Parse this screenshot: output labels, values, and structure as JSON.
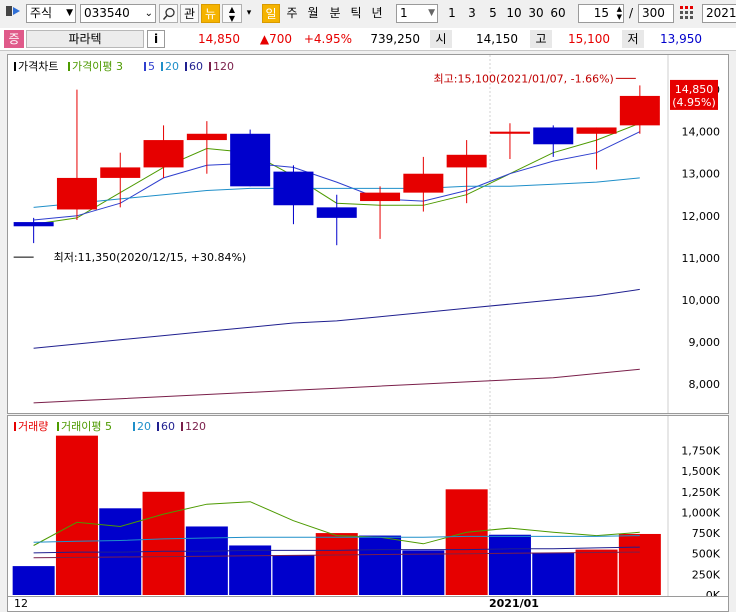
{
  "toolbar": {
    "market": "주식",
    "code": "033540",
    "btn_gwan": "관",
    "btn_new": "뉴",
    "period_buttons": [
      "일",
      "주",
      "월",
      "분",
      "틱",
      "년"
    ],
    "interval_value": "1",
    "quick_numbers": [
      "1",
      "3",
      "5",
      "10",
      "30",
      "60"
    ],
    "count_value": "15",
    "total_value": "300",
    "date_value": "2021/"
  },
  "infobar": {
    "badge": "증",
    "name": "파라텍",
    "info_btn": "i",
    "price": "14,850",
    "change": "▲700",
    "change_pct": "+4.95%",
    "volume": "739,250",
    "open_label": "시",
    "open": "14,150",
    "high_label": "고",
    "high": "15,100",
    "low_label": "저",
    "low": "13,950"
  },
  "colors": {
    "up": "#e60000",
    "down": "#0000cc",
    "ma5": "#4d9a00",
    "ma20": "#2f3fce",
    "ma60": "#1f8fc9",
    "ma120": "#7a1f4a"
  },
  "price_legend": [
    {
      "text": "가격차트",
      "color": "#000000"
    },
    {
      "text": "가격이평 3",
      "color": "#4d9a00"
    },
    {
      "text": "5",
      "color": "#2f3fce"
    },
    {
      "text": "20",
      "color": "#1f8fc9"
    },
    {
      "text": "60",
      "color": "#1f1f8f"
    },
    {
      "text": "120",
      "color": "#7a1f4a"
    }
  ],
  "volume_legend": [
    {
      "text": "거래량",
      "color": "#e60000"
    },
    {
      "text": "거래이평 5",
      "color": "#4d9a00"
    },
    {
      "text": "20",
      "color": "#1f8fc9"
    },
    {
      "text": "60",
      "color": "#1f1f8f"
    },
    {
      "text": "120",
      "color": "#7a1f4a"
    }
  ],
  "annotations": {
    "high": "최고:15,100(2021/01/07, -1.66%)",
    "low": "최저:11,350(2020/12/15, +30.84%)",
    "last_price": "14,850",
    "last_pct": "(4.95%)"
  },
  "x_labels": {
    "left": "12",
    "month": "2021/01"
  },
  "chart_data": [
    {
      "type": "candlestick",
      "title": "가격차트",
      "ylim": [
        7500,
        15300
      ],
      "y_ticks": [
        8000,
        9000,
        10000,
        11000,
        12000,
        13000,
        14000,
        15000
      ],
      "y_tick_labels": [
        "8,000",
        "9,000",
        "10,000",
        "11,000",
        "12,000",
        "13,000",
        "14,000",
        "15,000"
      ],
      "candles": [
        {
          "o": 11850,
          "h": 11950,
          "l": 11350,
          "c": 11750
        },
        {
          "o": 12150,
          "h": 15000,
          "l": 11900,
          "c": 12900
        },
        {
          "o": 12900,
          "h": 13500,
          "l": 12200,
          "c": 13150
        },
        {
          "o": 13150,
          "h": 14150,
          "l": 12900,
          "c": 13800
        },
        {
          "o": 13800,
          "h": 14250,
          "l": 13000,
          "c": 13950
        },
        {
          "o": 13950,
          "h": 14050,
          "l": 12700,
          "c": 12700
        },
        {
          "o": 13050,
          "h": 13200,
          "l": 11800,
          "c": 12250
        },
        {
          "o": 12200,
          "h": 12500,
          "l": 11300,
          "c": 11950
        },
        {
          "o": 12350,
          "h": 12700,
          "l": 11450,
          "c": 12550
        },
        {
          "o": 12550,
          "h": 13400,
          "l": 12100,
          "c": 13000
        },
        {
          "o": 13150,
          "h": 13800,
          "l": 12300,
          "c": 13450
        },
        {
          "o": 13950,
          "h": 14200,
          "l": 13350,
          "c": 14000
        },
        {
          "o": 14100,
          "h": 14150,
          "l": 13400,
          "c": 13700
        },
        {
          "o": 13950,
          "h": 14100,
          "l": 13100,
          "c": 14100
        },
        {
          "o": 14150,
          "h": 15100,
          "l": 13950,
          "c": 14850
        }
      ],
      "series": [
        {
          "name": "3",
          "values": [
            11800,
            11950,
            12550,
            13150,
            13600,
            13500,
            12950,
            12300,
            12250,
            12250,
            12500,
            13000,
            13500,
            13800,
            14200
          ]
        },
        {
          "name": "5",
          "values": [
            11900,
            12000,
            12300,
            12900,
            13200,
            13250,
            13150,
            12800,
            12400,
            12350,
            12600,
            13000,
            13300,
            13500,
            14000
          ]
        },
        {
          "name": "20",
          "values": [
            12200,
            12300,
            12400,
            12500,
            12600,
            12650,
            12650,
            12650,
            12650,
            12650,
            12700,
            12700,
            12750,
            12800,
            12900
          ]
        },
        {
          "name": "60",
          "values": [
            8850,
            8950,
            9050,
            9150,
            9250,
            9350,
            9450,
            9500,
            9600,
            9700,
            9800,
            9900,
            10000,
            10100,
            10250
          ]
        },
        {
          "name": "120",
          "values": [
            7550,
            7600,
            7650,
            7700,
            7750,
            7800,
            7850,
            7900,
            7950,
            8000,
            8050,
            8100,
            8150,
            8250,
            8350
          ]
        }
      ]
    },
    {
      "type": "bar",
      "title": "거래량",
      "ylim": [
        0,
        1950000
      ],
      "y_ticks": [
        0,
        250000,
        500000,
        750000,
        1000000,
        1250000,
        1500000,
        1750000
      ],
      "y_tick_labels": [
        "0K",
        "250K",
        "500K",
        "750K",
        "1,000K",
        "1,250K",
        "1,500K",
        "1,750K"
      ],
      "values": [
        350000,
        1930000,
        1050000,
        1250000,
        830000,
        600000,
        480000,
        750000,
        720000,
        540000,
        1280000,
        730000,
        510000,
        550000,
        739250
      ],
      "up": [
        false,
        true,
        false,
        true,
        false,
        false,
        false,
        true,
        false,
        false,
        true,
        false,
        false,
        true,
        true
      ],
      "series": [
        {
          "name": "5",
          "values": [
            600000,
            880000,
            830000,
            980000,
            1100000,
            1130000,
            900000,
            720000,
            700000,
            620000,
            760000,
            810000,
            760000,
            720000,
            760000
          ]
        },
        {
          "name": "20",
          "values": [
            640000,
            650000,
            660000,
            680000,
            690000,
            700000,
            700000,
            700000,
            700000,
            700000,
            710000,
            710000,
            710000,
            710000,
            720000
          ]
        },
        {
          "name": "60",
          "values": [
            510000,
            520000,
            520000,
            530000,
            530000,
            540000,
            540000,
            540000,
            550000,
            550000,
            550000,
            560000,
            560000,
            570000,
            580000
          ]
        },
        {
          "name": "120",
          "values": [
            450000,
            455000,
            460000,
            465000,
            470000,
            475000,
            480000,
            485000,
            490000,
            495000,
            500000,
            505000,
            510000,
            515000,
            520000
          ]
        }
      ]
    }
  ]
}
